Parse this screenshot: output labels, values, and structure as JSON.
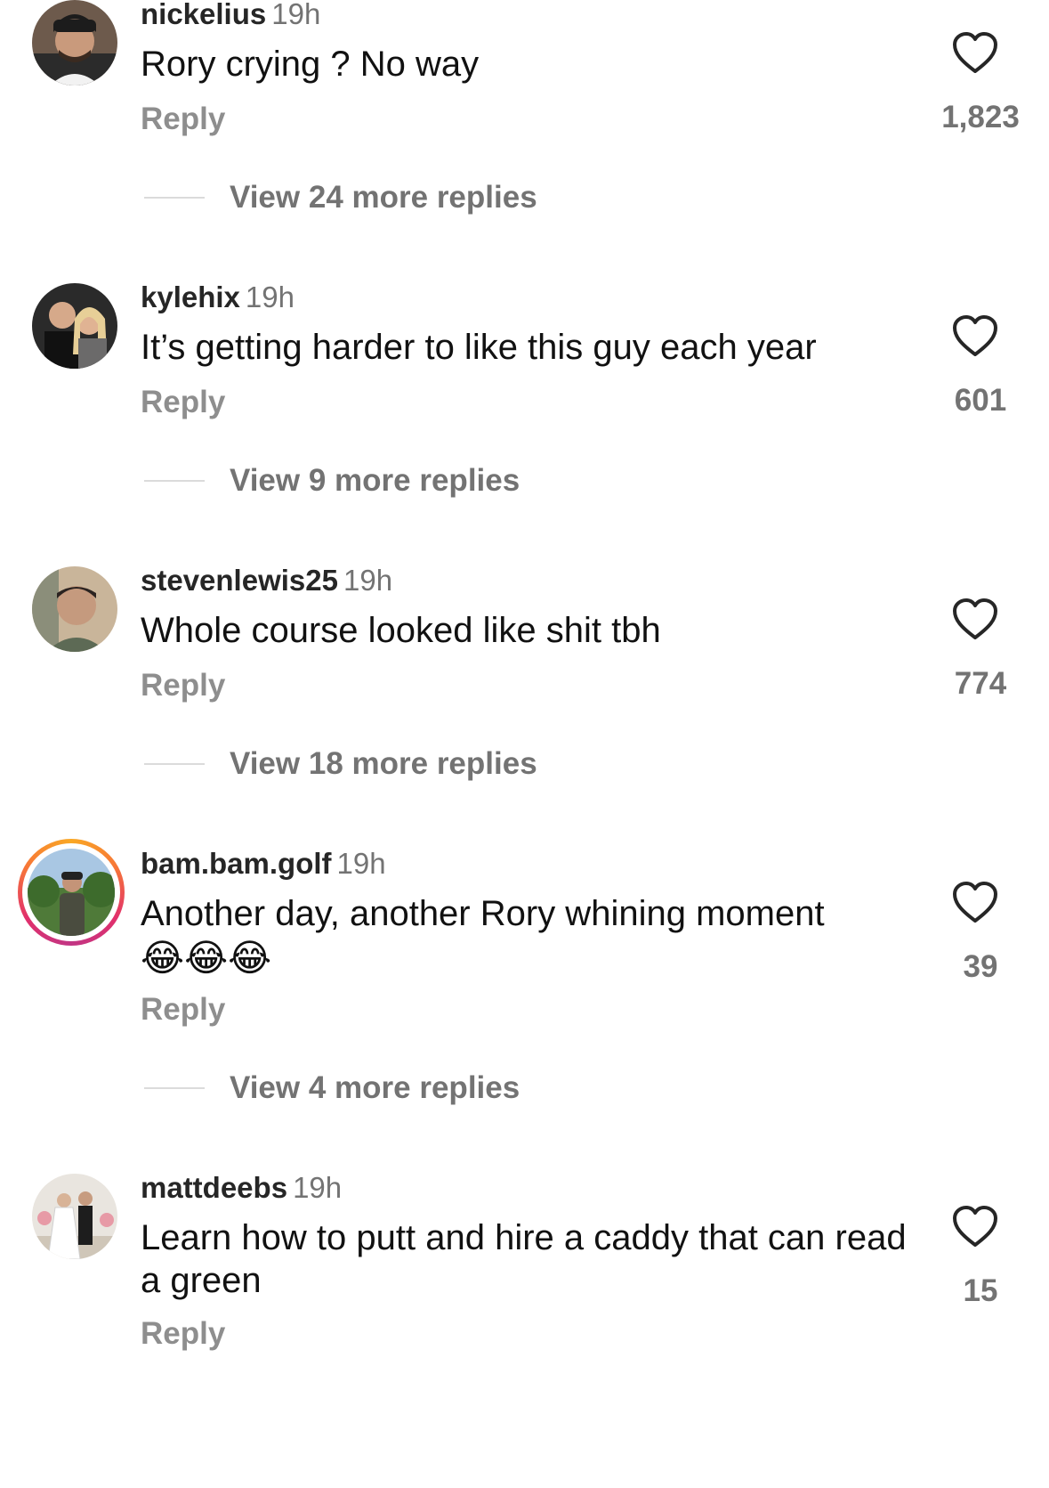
{
  "comments": [
    {
      "username": "nickelius",
      "time": "19h",
      "text": "Rory crying ? No way",
      "reply": "Reply",
      "likes": "1,823",
      "view_more": "View 24 more replies",
      "like_icon": "heart-outline-icon"
    },
    {
      "username": "kylehix",
      "time": "19h",
      "text": "It’s getting harder to like this guy each year",
      "reply": "Reply",
      "likes": "601",
      "view_more": "View 9 more replies",
      "like_icon": "heart-outline-icon"
    },
    {
      "username": "stevenlewis25",
      "time": "19h",
      "text": "Whole course looked like shit tbh",
      "reply": "Reply",
      "likes": "774",
      "view_more": "View 18 more replies",
      "like_icon": "heart-outline-icon"
    },
    {
      "username": "bam.bam.golf",
      "time": "19h",
      "text": "Another day, another Rory whining moment",
      "emoji": "😂😂😂",
      "reply": "Reply",
      "likes": "39",
      "view_more": "View 4 more replies",
      "like_icon": "heart-outline-icon",
      "has_story_ring": true
    },
    {
      "username": "mattdeebs",
      "time": "19h",
      "text": "Learn how to putt and hire a caddy that can read a green",
      "reply": "Reply",
      "likes": "15",
      "like_icon": "heart-outline-icon"
    }
  ],
  "colors": {
    "username": "#262626",
    "secondary_text": "#737373",
    "reply": "#8e8e8e",
    "divider": "#dbdbdb"
  }
}
